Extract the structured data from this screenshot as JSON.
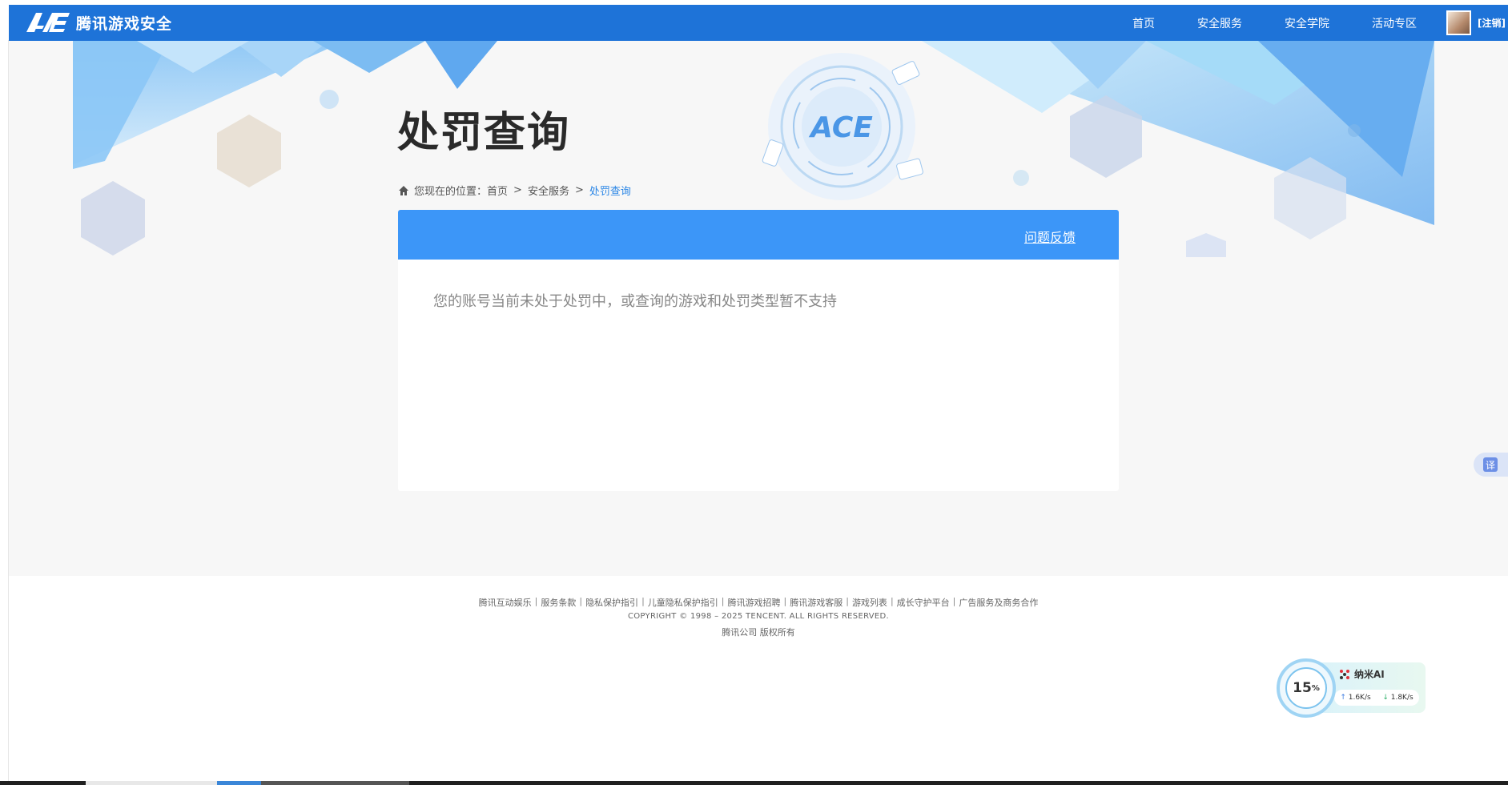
{
  "header": {
    "logo_text": "腾讯游戏安全",
    "nav": [
      "首页",
      "安全服务",
      "安全学院",
      "活动专区"
    ],
    "user_link": "[注销]"
  },
  "page": {
    "title": "处罚查询",
    "breadcrumb": {
      "prefix": "您现在的位置：",
      "items": [
        "首页",
        "安全服务"
      ],
      "current": "处罚查询",
      "separator": ">"
    }
  },
  "panel": {
    "feedback_label": "问题反馈",
    "message": "您的账号当前未处于处罚中，或查询的游戏和处罚类型暂不支持"
  },
  "footer": {
    "links": [
      "腾讯互动娱乐",
      "服务条款",
      "隐私保护指引",
      "儿童隐私保护指引",
      "腾讯游戏招聘",
      "腾讯游戏客服",
      "游戏列表",
      "成长守护平台",
      "广告服务及商务合作"
    ],
    "copyright": "COPYRIGHT © 1998 – 2025 TENCENT. ALL RIGHTS RESERVED.",
    "company": "腾讯公司 版权所有"
  },
  "translate_button": {
    "label": "译"
  },
  "speed_widget": {
    "percent": "15",
    "percent_unit": "%",
    "brand": "纳米AI",
    "upload": "1.6K/s",
    "download": "1.8K/s"
  },
  "colors": {
    "header_bg": "#1e73d8",
    "panel_head_bg": "#3c96f8",
    "breadcrumb_current": "#2a86e6"
  }
}
